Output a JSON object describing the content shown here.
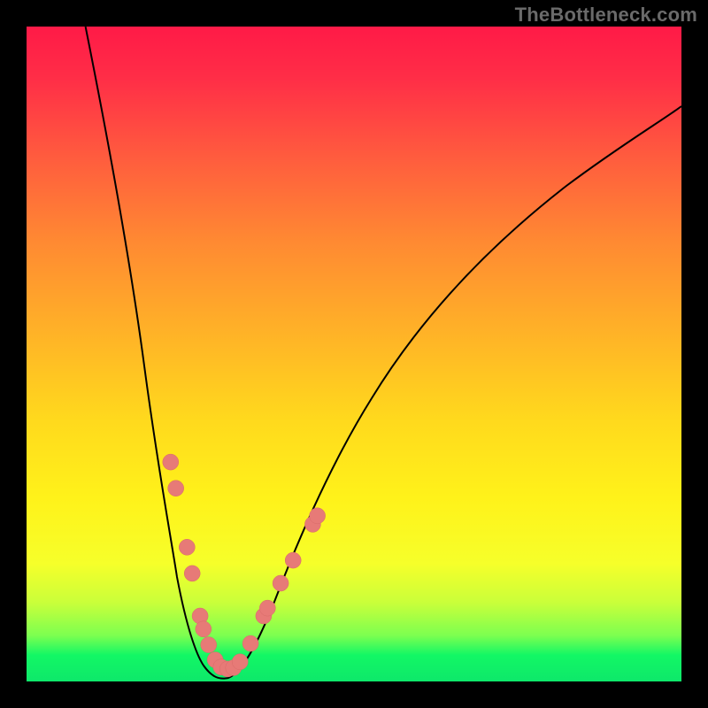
{
  "watermark": "TheBottleneck.com",
  "colors": {
    "frame_border": "#000000",
    "curve": "#000000",
    "dots": "#e77a77",
    "gradient_top": "#ff1a47",
    "gradient_bottom": "#0ee86a"
  },
  "chart_data": {
    "type": "line",
    "title": "",
    "xlabel": "",
    "ylabel": "",
    "xlim": [
      0,
      100
    ],
    "ylim": [
      0,
      100
    ],
    "note": "Axes unlabeled; values estimated from pixel positions within 740×740 plot area, normalized to 0–100. y=0 at bottom, y=100 at top.",
    "series": [
      {
        "name": "bottleneck-curve",
        "x": [
          9,
          13,
          16,
          18,
          20,
          22,
          23.5,
          25,
          26.5,
          28,
          29.5,
          31,
          33,
          36,
          40,
          45,
          50,
          56,
          63,
          71,
          80,
          90,
          100
        ],
        "y": [
          100,
          80,
          63,
          52,
          42,
          32,
          24,
          17,
          10.5,
          5.8,
          2.6,
          2.0,
          3.5,
          9,
          17,
          27,
          36,
          45,
          55,
          64,
          73,
          81,
          88
        ]
      }
    ],
    "scatter": {
      "name": "highlighted-points",
      "points": [
        {
          "x": 22.0,
          "y": 33.5
        },
        {
          "x": 22.8,
          "y": 29.5
        },
        {
          "x": 24.5,
          "y": 20.5
        },
        {
          "x": 25.3,
          "y": 16.5
        },
        {
          "x": 26.5,
          "y": 10.0
        },
        {
          "x": 27.0,
          "y": 8.0
        },
        {
          "x": 27.8,
          "y": 5.6
        },
        {
          "x": 28.8,
          "y": 3.3
        },
        {
          "x": 29.7,
          "y": 2.2
        },
        {
          "x": 30.7,
          "y": 1.9
        },
        {
          "x": 31.6,
          "y": 2.1
        },
        {
          "x": 32.6,
          "y": 3.0
        },
        {
          "x": 34.2,
          "y": 5.8
        },
        {
          "x": 36.2,
          "y": 10.0
        },
        {
          "x": 36.8,
          "y": 11.2
        },
        {
          "x": 38.8,
          "y": 15.0
        },
        {
          "x": 40.7,
          "y": 18.5
        },
        {
          "x": 43.7,
          "y": 24.0
        },
        {
          "x": 44.4,
          "y": 25.3
        }
      ]
    }
  }
}
